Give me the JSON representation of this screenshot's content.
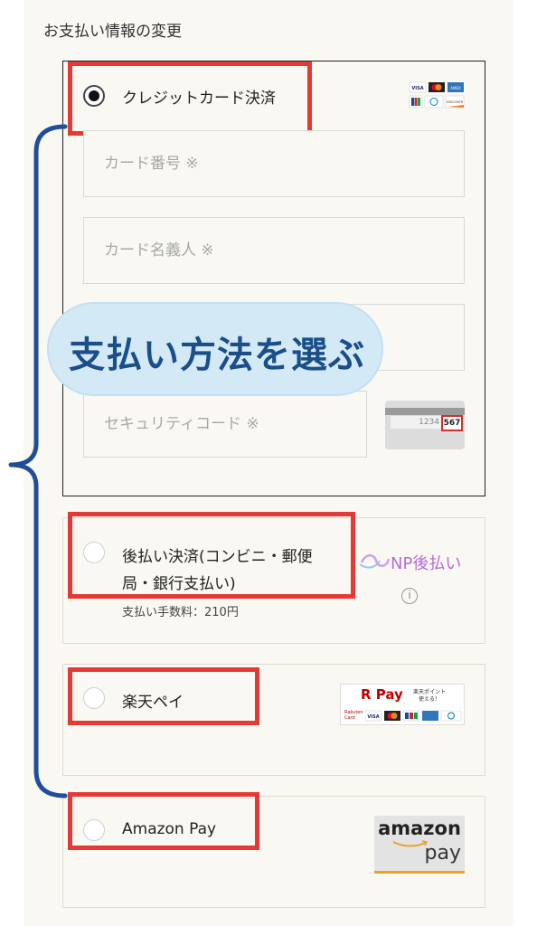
{
  "section_title": "お支払い情報の変更",
  "credit": {
    "label": "クレジットカード決済",
    "card_number_placeholder": "カード番号 ※",
    "card_name_placeholder": "カード名義人 ※",
    "security_code_placeholder": "セキュリティコード ※",
    "security_digits_prefix": "1234",
    "security_digits": "567",
    "brands": [
      "VISA",
      "mastercard",
      "AMEX",
      "JCB",
      "Diners",
      "DISCOVER"
    ]
  },
  "deferred": {
    "label_line1": "後払い決済(コンビニ・郵便",
    "label_line2": "局・銀行支払い)",
    "fee": "支払い手数料：210円",
    "logo_text": "NP後払い"
  },
  "rakuten": {
    "label": "楽天ペイ",
    "logo_title": "R Pay",
    "logo_sub1": "楽天ポイント",
    "logo_sub2": "使える！",
    "logo_brand": "Rakuten Card"
  },
  "amazon": {
    "label": "Amazon Pay",
    "logo_top": "amazon",
    "logo_bottom": "pay"
  },
  "annotation": "支払い方法を選ぶ",
  "colors": {
    "highlight_red": "#e53935",
    "bracket_blue": "#1f4e9a",
    "bubble_fill": "#d4e9f6",
    "bubble_text": "#1a4f8a",
    "np_purple": "#b86bd6"
  }
}
